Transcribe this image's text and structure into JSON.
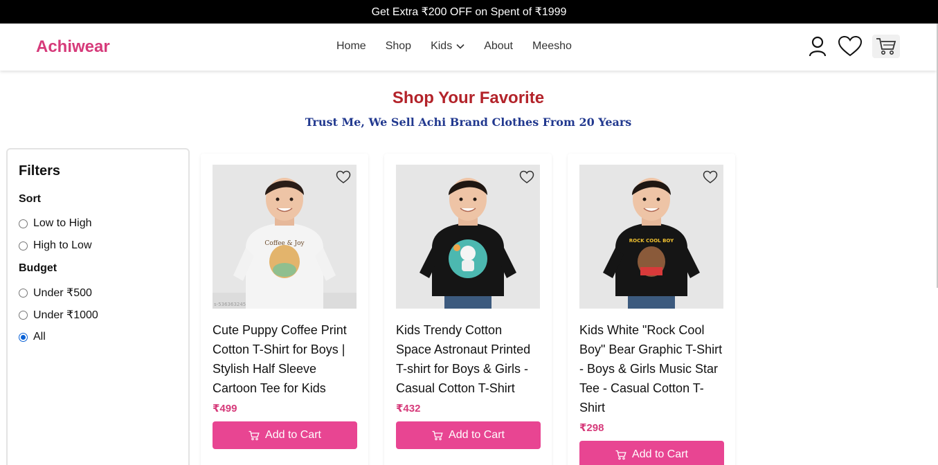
{
  "promo": {
    "text": "Get Extra ₹200 OFF on Spent of ₹1999"
  },
  "header": {
    "brand": "Achiwear",
    "nav": [
      "Home",
      "Shop",
      "Kids",
      "About",
      "Meesho"
    ],
    "icons": [
      "user-icon",
      "heart-icon",
      "cart-icon"
    ]
  },
  "hero": {
    "title": "Shop Your Favorite",
    "subtitle": "Trust Me, We Sell Achi Brand Clothes From 20 Years"
  },
  "filters": {
    "title": "Filters",
    "sort": {
      "title": "Sort",
      "options": [
        "Low to High",
        "High to Low"
      ],
      "selected": null
    },
    "budget": {
      "title": "Budget",
      "options": [
        "Under ₹500",
        "Under ₹1000",
        "All"
      ],
      "selected": "All"
    }
  },
  "products": [
    {
      "title": "Cute Puppy Coffee Print Cotton T-Shirt for Boys | Stylish Half Sleeve Cartoon Tee for Kids",
      "price": "₹499",
      "button": "Add to Cart",
      "shirt_color": "#f4f4f4",
      "print_text": "Coffee & Joy",
      "watermark": "s-536363245"
    },
    {
      "title": "Kids Trendy Cotton Space Astronaut Printed T-shirt for Boys & Girls - Casual Cotton T-Shirt",
      "price": "₹432",
      "button": "Add to Cart",
      "shirt_color": "#151515",
      "print_text": "",
      "watermark": ""
    },
    {
      "title": "Kids White \"Rock Cool Boy\" Bear Graphic T-Shirt - Boys & Girls Music Star Tee - Casual Cotton T-Shirt",
      "price": "₹298",
      "button": "Add to Cart",
      "shirt_color": "#151515",
      "print_text": "ROCK COOL BOY",
      "watermark": ""
    }
  ],
  "colors": {
    "brand": "#d63a7a",
    "hero_title": "#b3232a",
    "hero_subtitle": "#22398f",
    "button": "#e84592",
    "price": "#d63a7a"
  }
}
